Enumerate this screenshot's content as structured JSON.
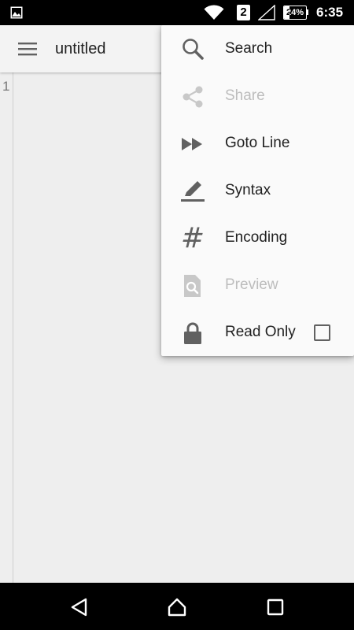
{
  "status_bar": {
    "sim_slot": "2",
    "battery_percent": "24%",
    "battery_level": 0.24,
    "time": "6:35"
  },
  "app_bar": {
    "menu_icon": "hamburger-menu-icon",
    "title": "untitled"
  },
  "editor": {
    "line_number": "1",
    "content": ""
  },
  "menu": {
    "items": [
      {
        "label": "Search",
        "icon": "search-icon",
        "enabled": true
      },
      {
        "label": "Share",
        "icon": "share-icon",
        "enabled": false
      },
      {
        "label": "Goto Line",
        "icon": "fast-forward-icon",
        "enabled": true
      },
      {
        "label": "Syntax",
        "icon": "highlighter-icon",
        "enabled": true
      },
      {
        "label": "Encoding",
        "icon": "hash-icon",
        "enabled": true,
        "glyph": "#"
      },
      {
        "label": "Preview",
        "icon": "preview-file-icon",
        "enabled": false
      },
      {
        "label": "Read Only",
        "icon": "lock-icon",
        "enabled": true,
        "checked": false
      }
    ]
  },
  "colors": {
    "enabled_text": "#212121",
    "disabled_text": "#bdbdbd",
    "icon": "#616161",
    "disabled_icon": "#c8c8c8",
    "background": "#eeeeee"
  },
  "nav_bar": {
    "icons": [
      "back-icon",
      "home-icon",
      "recents-icon"
    ]
  }
}
